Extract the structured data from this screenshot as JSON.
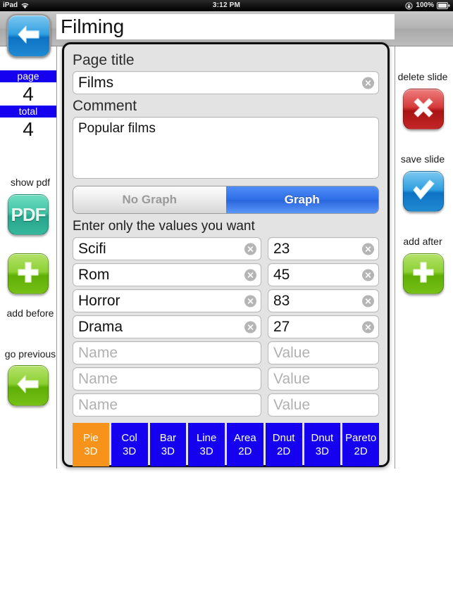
{
  "status_bar": {
    "device": "iPad",
    "wifi_icon": "wifi-icon",
    "time": "3:12 PM",
    "rotation_lock_icon": "rotation-lock-icon",
    "battery_percent": "100%",
    "battery_icon": "battery-icon"
  },
  "navbar": {
    "back_icon": "back-arrow-icon",
    "title_value": "Filming",
    "title_placeholder": "Title"
  },
  "left_sidebar": {
    "page_label": "page",
    "page_value": "4",
    "total_label": "total",
    "total_value": "4",
    "show_pdf_label": "show pdf",
    "pdf_icon_text": "PDF",
    "add_before_label": "add before",
    "add_before_icon": "plus-icon",
    "go_previous_label": "go previous",
    "go_previous_icon": "left-arrow-icon"
  },
  "right_sidebar": {
    "delete_slide_label": "delete slide",
    "delete_slide_icon": "x-mark-icon",
    "save_slide_label": "save slide",
    "save_slide_icon": "checkmark-icon",
    "add_after_label": "add after",
    "add_after_icon": "plus-icon"
  },
  "dialog": {
    "page_title_label": "Page title",
    "page_title_value": "Films",
    "page_title_placeholder": "Page title",
    "comment_label": "Comment",
    "comment_value": "Popular films",
    "comment_placeholder": "Comment",
    "segmented": {
      "no_graph_label": "No Graph",
      "graph_label": "Graph",
      "selected": "Graph"
    },
    "hint": "Enter only the values you want",
    "name_placeholder": "Name",
    "value_placeholder": "Value",
    "rows": [
      {
        "name": "Scifi",
        "value": "23"
      },
      {
        "name": "Rom",
        "value": "45"
      },
      {
        "name": "Horror",
        "value": "83"
      },
      {
        "name": "Drama",
        "value": "27"
      },
      {
        "name": "",
        "value": ""
      },
      {
        "name": "",
        "value": ""
      },
      {
        "name": "",
        "value": ""
      }
    ],
    "chart_types": [
      {
        "line1": "Pie",
        "line2": "3D",
        "selected": true
      },
      {
        "line1": "Col",
        "line2": "3D",
        "selected": false
      },
      {
        "line1": "Bar",
        "line2": "3D",
        "selected": false
      },
      {
        "line1": "Line",
        "line2": "3D",
        "selected": false
      },
      {
        "line1": "Area",
        "line2": "2D",
        "selected": false
      },
      {
        "line1": "Dnut",
        "line2": "2D",
        "selected": false
      },
      {
        "line1": "Dnut",
        "line2": "3D",
        "selected": false
      },
      {
        "line1": "Pareto",
        "line2": "2D",
        "selected": false
      }
    ]
  },
  "colors": {
    "accent_blue": "#1500f0",
    "selected_orange": "#f7931a",
    "segment_on": "#2f6fe8",
    "dialog_bg": "#e3e3e3"
  }
}
